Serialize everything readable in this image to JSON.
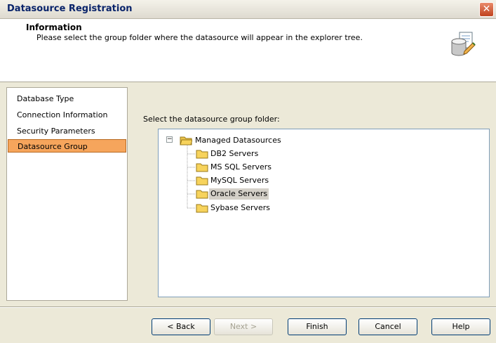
{
  "window": {
    "title": "Datasource Registration",
    "close_glyph": "✕"
  },
  "header": {
    "title": "Information",
    "description": "Please select the group folder where the datasource will appear in the explorer tree.",
    "icon": "database-edit-icon"
  },
  "nav": {
    "items": [
      {
        "label": "Database Type",
        "active": false
      },
      {
        "label": "Connection Information",
        "active": false
      },
      {
        "label": "Security Parameters",
        "active": false
      },
      {
        "label": "Datasource Group",
        "active": true
      }
    ]
  },
  "main": {
    "prompt": "Select the datasource group folder:",
    "tree": {
      "root": {
        "label": "Managed Datasources",
        "expanded": true,
        "expander_glyph": "−"
      },
      "children": [
        {
          "label": "DB2 Servers",
          "selected": false
        },
        {
          "label": "MS SQL Servers",
          "selected": false
        },
        {
          "label": "MySQL Servers",
          "selected": false
        },
        {
          "label": "Oracle Servers",
          "selected": true
        },
        {
          "label": "Sybase Servers",
          "selected": false
        }
      ]
    }
  },
  "buttons": {
    "back": "< Back",
    "next": "Next >",
    "finish": "Finish",
    "cancel": "Cancel",
    "help": "Help"
  },
  "colors": {
    "active_nav": "#f6a55c",
    "title_text": "#0a246a",
    "close_button": "#c0431f",
    "folder": "#f7d35c"
  }
}
